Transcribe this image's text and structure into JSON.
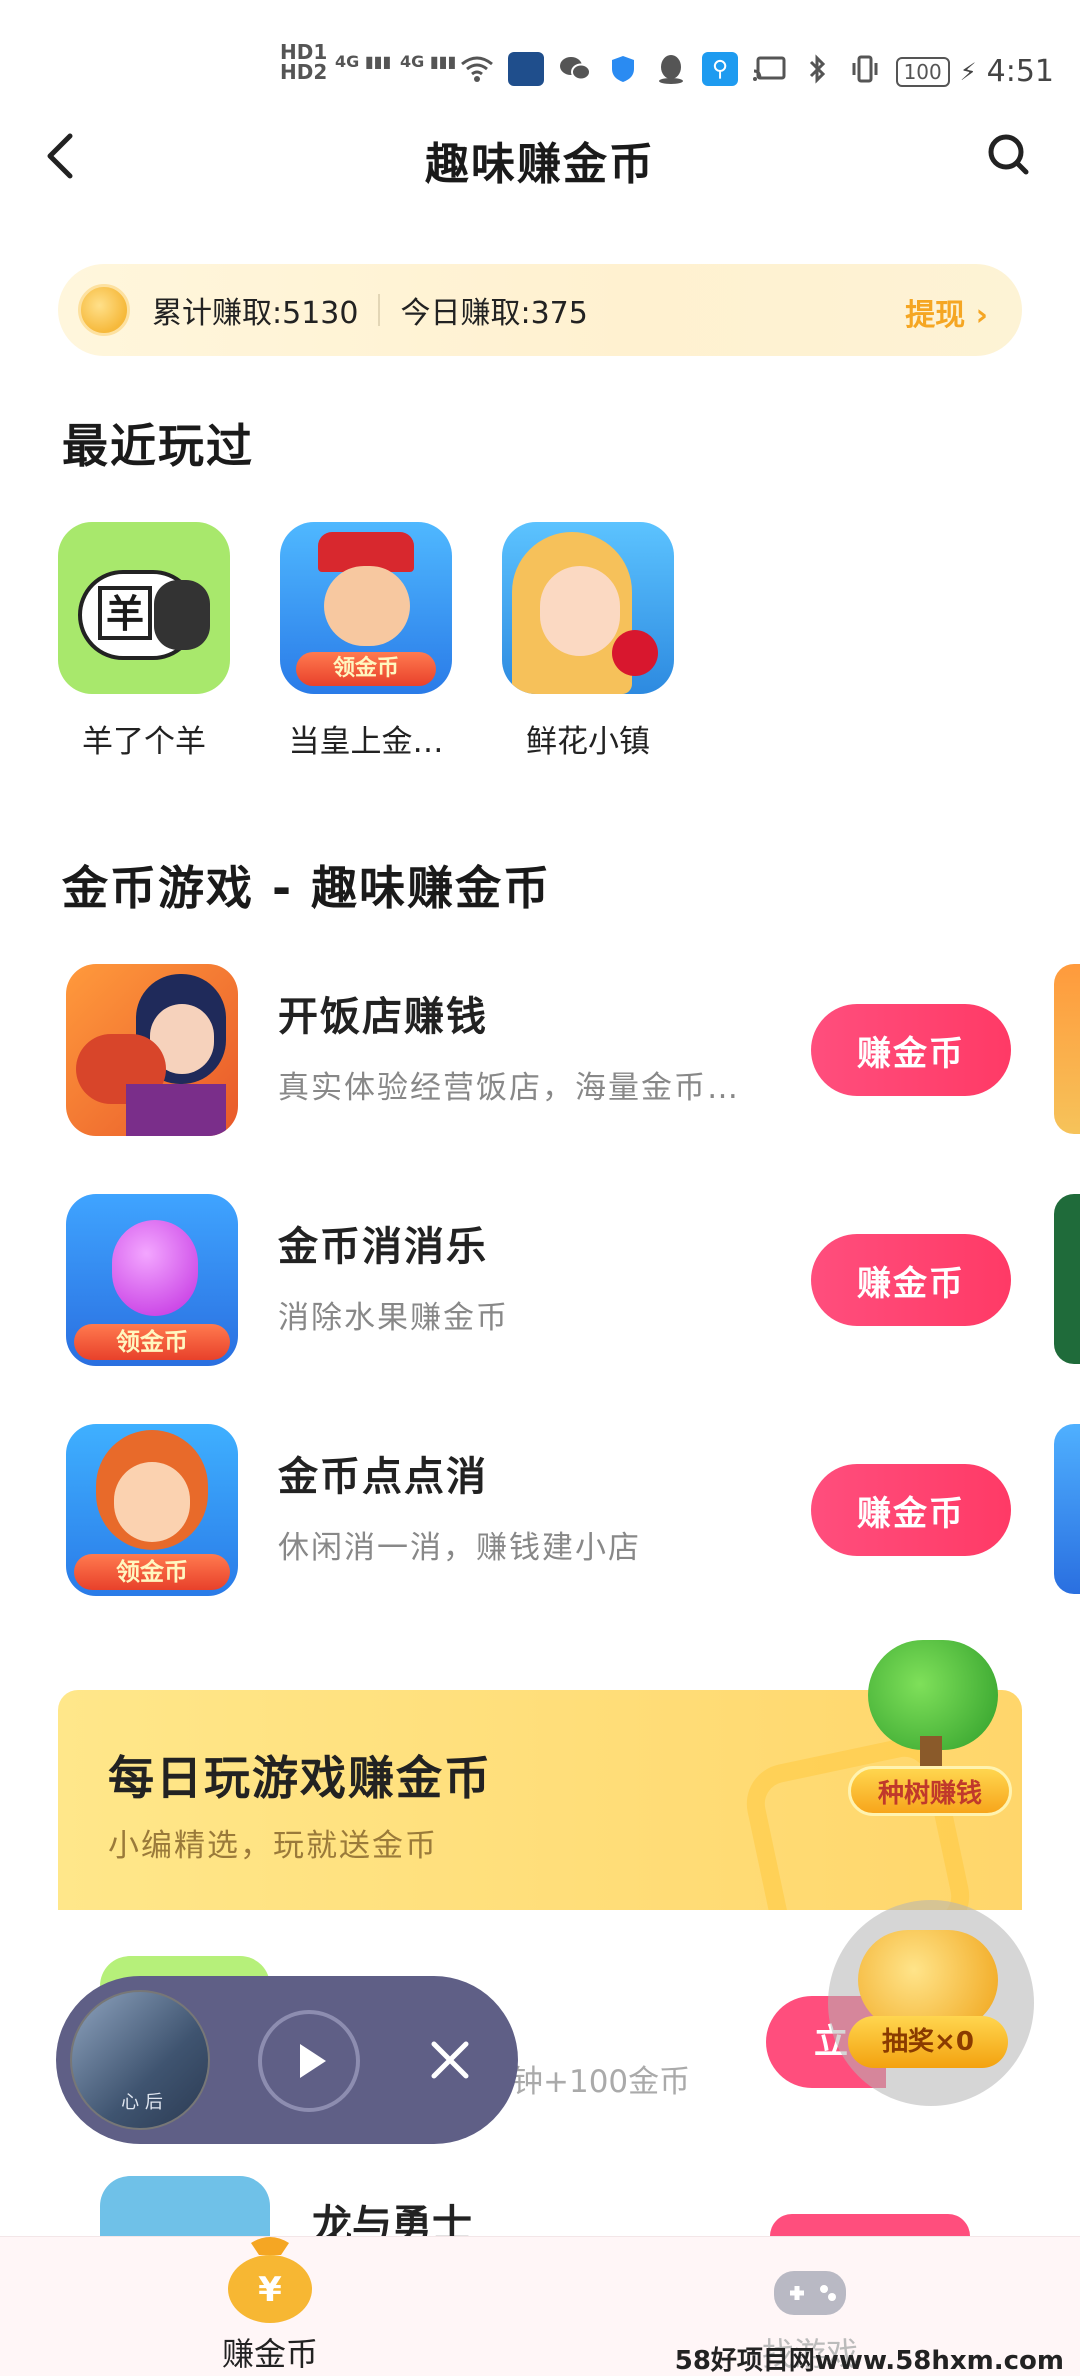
{
  "status_bar": {
    "hd1": "HD1",
    "hd2": "HD2",
    "signal1": "4G",
    "signal2": "4G",
    "battery": "100",
    "time": "4:51"
  },
  "header": {
    "title": "趣味赚金币"
  },
  "earnings": {
    "total": "累计赚取:5130",
    "today": "今日赚取:375",
    "withdraw": "提现 ›"
  },
  "recent": {
    "title": "最近玩过",
    "items": [
      {
        "label": "羊了个羊",
        "icon": "sheep-game-icon",
        "badge": "羊"
      },
      {
        "label": "当皇上金…",
        "icon": "emperor-game-icon",
        "badge": "领金币"
      },
      {
        "label": "鲜花小镇",
        "icon": "flower-town-game-icon",
        "badge": ""
      }
    ]
  },
  "coin_games": {
    "title": "金币游戏 - 趣味赚金币",
    "items": [
      {
        "name": "开饭店赚钱",
        "desc": "真实体验经营饭店，海量金币…",
        "button": "赚金币",
        "badge": ""
      },
      {
        "name": "金币消消乐",
        "desc": "消除水果赚金币",
        "button": "赚金币",
        "badge": "领金币"
      },
      {
        "name": "金币点点消",
        "desc": "休闲消一消，赚钱建小店",
        "button": "赚金币",
        "badge": "领金币"
      }
    ]
  },
  "daily": {
    "title": "每日玩游戏赚金币",
    "subtitle": "小编精选，玩就送金币"
  },
  "floating": {
    "tree": "种树赚钱",
    "lottery": "抽奖×0"
  },
  "hidden_rows": {
    "row1_text": "钟+100金币",
    "row1_button": "立",
    "row2_name": "龙与勇士"
  },
  "player": {
    "art_text": "心 后"
  },
  "nav": {
    "items": [
      {
        "label": "赚金币",
        "icon": "money-bag-icon"
      },
      {
        "label": "找游戏",
        "icon": "gamepad-icon"
      }
    ]
  },
  "watermark": "58好项目网www.58hxm.com",
  "colors": {
    "accent": "#ff4e7d",
    "gold": "#f5a623",
    "banner": "#ffe08a"
  }
}
